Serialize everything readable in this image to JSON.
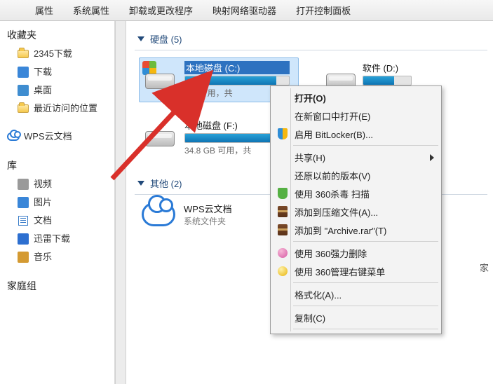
{
  "cmdbar": {
    "items": [
      "属性",
      "系统属性",
      "卸载或更改程序",
      "映射网络驱动器",
      "打开控制面板"
    ]
  },
  "nav": {
    "favorites": {
      "title": "收藏夹",
      "items": [
        {
          "label": "2345下载"
        },
        {
          "label": "下载"
        },
        {
          "label": "桌面"
        },
        {
          "label": "最近访问的位置"
        }
      ]
    },
    "wps": {
      "label": "WPS云文档"
    },
    "libraries": {
      "title": "库",
      "items": [
        {
          "label": "视频"
        },
        {
          "label": "图片"
        },
        {
          "label": "文档"
        },
        {
          "label": "迅雷下载"
        },
        {
          "label": "音乐"
        }
      ]
    },
    "homegroup": {
      "title": "家庭组"
    }
  },
  "sections": {
    "drives": {
      "title": "硬盘 (5)"
    },
    "other": {
      "title": "其他 (2)"
    }
  },
  "drives": [
    {
      "name": "本地磁盘 (C:)",
      "free_text": "GB 可用，共",
      "fill_pct": 88,
      "selected": true,
      "os": true
    },
    {
      "name": "软件 (D:)",
      "fill_pct": 65
    },
    {
      "name": "本地磁盘 (F:)",
      "free_text": "34.8 GB 可用，共",
      "fill_pct": 94
    }
  ],
  "other_items": [
    {
      "name": "WPS云文档",
      "subtitle": "系统文件夹"
    }
  ],
  "context_menu": {
    "items": [
      {
        "label": "打开(O)",
        "default": true
      },
      {
        "label": "在新窗口中打开(E)"
      },
      {
        "label": "启用 BitLocker(B)...",
        "icon": "shield"
      },
      {
        "sep": true
      },
      {
        "label": "共享(H)",
        "submenu": true
      },
      {
        "label": "还原以前的版本(V)"
      },
      {
        "label": "使用 360杀毒 扫描",
        "icon": "gshield"
      },
      {
        "label": "添加到压缩文件(A)...",
        "icon": "rar"
      },
      {
        "label": "添加到 \"Archive.rar\"(T)",
        "icon": "rar"
      },
      {
        "sep": true
      },
      {
        "label": "使用 360强力删除",
        "icon": "pinkball"
      },
      {
        "label": "使用 360管理右键菜单",
        "icon": "y360"
      },
      {
        "sep": true
      },
      {
        "label": "格式化(A)..."
      },
      {
        "sep": true
      },
      {
        "label": "复制(C)"
      },
      {
        "sep": true
      }
    ]
  },
  "stray": "家"
}
